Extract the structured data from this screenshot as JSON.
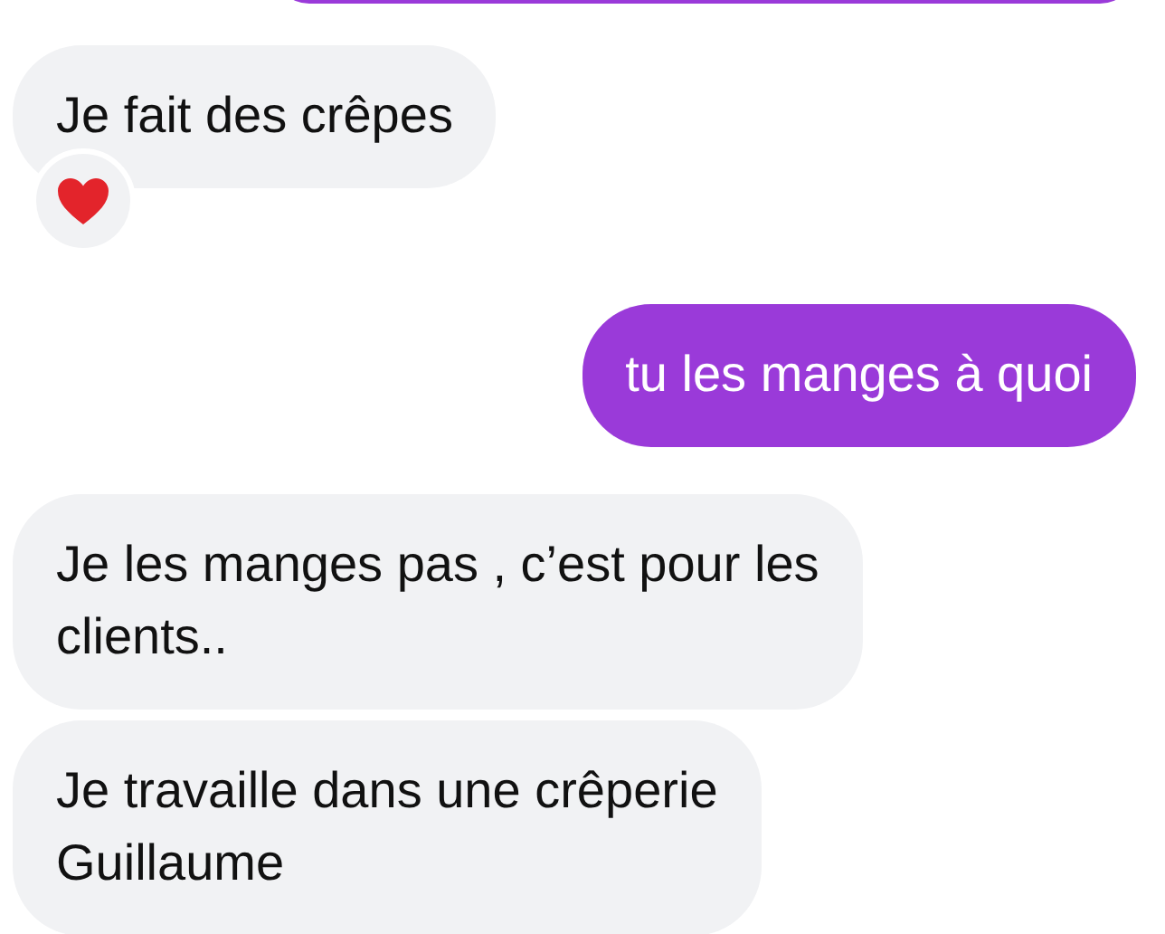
{
  "messages": [
    {
      "kind": "sent"
    },
    {
      "kind": "received",
      "text": "Je fait des crêpes",
      "reaction": {
        "kind": "heart"
      }
    },
    {
      "kind": "sent",
      "text": "tu les manges à quoi"
    },
    {
      "kind": "received",
      "text": "Je les manges pas , c’est pour les\nclients.."
    },
    {
      "kind": "received",
      "text": "Je travaille dans une crêperie\nGuillaume"
    }
  ]
}
